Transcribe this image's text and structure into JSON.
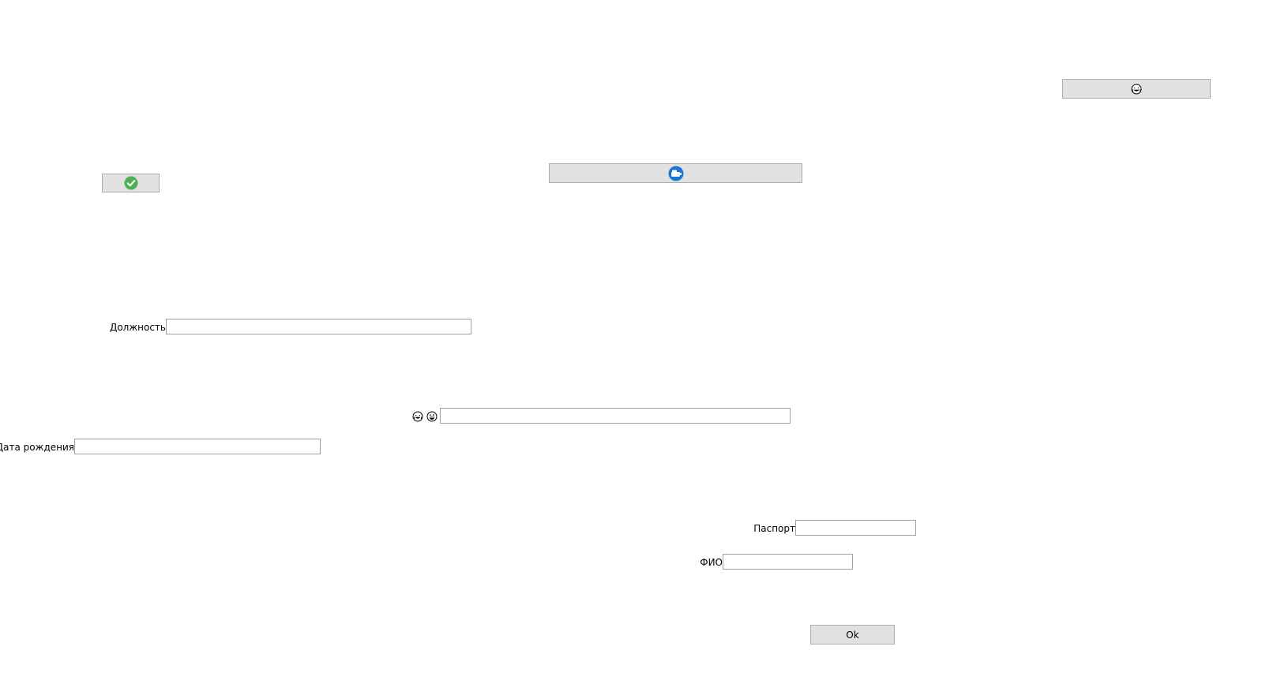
{
  "buttons": {
    "ok_label": "Ok"
  },
  "icons": {
    "top_right_button": "laughing-face-icon",
    "check_button": "green-checkmark-icon",
    "center_button": "blue-round-app-icon",
    "field_icon_1": "laughing-face-icon",
    "field_icon_2": "grinning-face-icon"
  },
  "fields": {
    "position_label": "Должность",
    "position_value": "",
    "emoji_field_value": "",
    "birthdate_label": "Дата рождения",
    "birthdate_value": "",
    "passport_label": "Паспорт",
    "passport_value": "",
    "fio_label": "ФИО",
    "fio_value": ""
  },
  "colors": {
    "button_bg": "#e1e1e1",
    "check_green": "#4caf50",
    "app_blue": "#1976d2"
  }
}
